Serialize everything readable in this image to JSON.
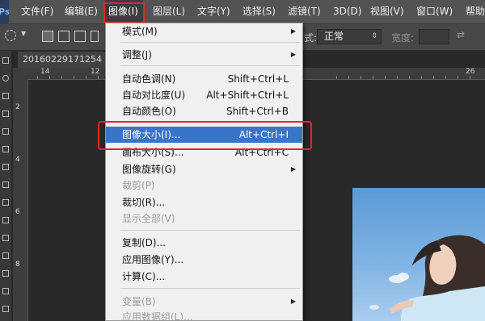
{
  "menubar": {
    "logo": "Ps",
    "items": [
      {
        "label": "文件(F)"
      },
      {
        "label": "编辑(E)"
      },
      {
        "label": "图像(I)"
      },
      {
        "label": "图层(L)"
      },
      {
        "label": "文字(Y)"
      },
      {
        "label": "选择(S)"
      },
      {
        "label": "滤镜(T)"
      },
      {
        "label": "3D(D)"
      },
      {
        "label": "视图(V)"
      },
      {
        "label": "窗口(W)"
      },
      {
        "label": "帮助"
      }
    ]
  },
  "options_bar": {
    "style_label": "式:",
    "style_value": "正常",
    "width_label": "宽度:",
    "width_value": ""
  },
  "document": {
    "tab_title": "20160229171254",
    "ruler_top": [
      "14",
      "12",
      "26"
    ],
    "ruler_left": [
      "2",
      "4",
      "6",
      "8"
    ]
  },
  "image_menu": {
    "items": [
      {
        "label": "模式(M)",
        "shortcut": "",
        "submenu": true,
        "disabled": false
      },
      {
        "label": "调整(J)",
        "shortcut": "",
        "submenu": true,
        "disabled": false
      },
      {
        "label": "自动色调(N)",
        "shortcut": "Shift+Ctrl+L",
        "submenu": false,
        "disabled": false
      },
      {
        "label": "自动对比度(U)",
        "shortcut": "Alt+Shift+Ctrl+L",
        "submenu": false,
        "disabled": false
      },
      {
        "label": "自动颜色(O)",
        "shortcut": "Shift+Ctrl+B",
        "submenu": false,
        "disabled": false
      },
      {
        "label": "图像大小(I)...",
        "shortcut": "Alt+Ctrl+I",
        "submenu": false,
        "disabled": false,
        "highlighted": true
      },
      {
        "label": "画布大小(S)...",
        "shortcut": "Alt+Ctrl+C",
        "submenu": false,
        "disabled": false
      },
      {
        "label": "图像旋转(G)",
        "shortcut": "",
        "submenu": true,
        "disabled": false
      },
      {
        "label": "裁剪(P)",
        "shortcut": "",
        "submenu": false,
        "disabled": true
      },
      {
        "label": "裁切(R)...",
        "shortcut": "",
        "submenu": false,
        "disabled": false
      },
      {
        "label": "显示全部(V)",
        "shortcut": "",
        "submenu": false,
        "disabled": true
      },
      {
        "label": "复制(D)...",
        "shortcut": "",
        "submenu": false,
        "disabled": false
      },
      {
        "label": "应用图像(Y)...",
        "shortcut": "",
        "submenu": false,
        "disabled": false
      },
      {
        "label": "计算(C)...",
        "shortcut": "",
        "submenu": false,
        "disabled": false
      },
      {
        "label": "变量(B)",
        "shortcut": "",
        "submenu": true,
        "disabled": true
      },
      {
        "label": "应用数据组(L)...",
        "shortcut": "",
        "submenu": false,
        "disabled": true
      }
    ]
  },
  "colors": {
    "highlight_blue": "#3a74c8",
    "annotation_red": "#e1262b",
    "menubar_bg": "#535353"
  }
}
